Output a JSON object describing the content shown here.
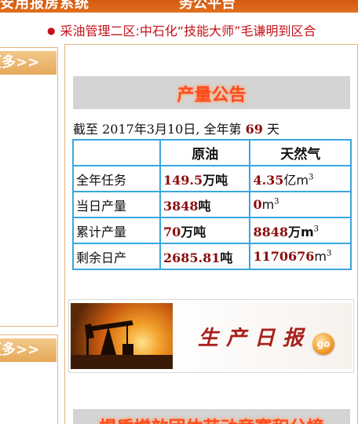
{
  "header": {
    "left_text": "安用报房系统",
    "right_text": "务公平台"
  },
  "news": {
    "text": "采油管理二区:中石化“技能大师”毛谦明到区合"
  },
  "sidebar": {
    "more_label_1": "更多>>",
    "more_label_2": "更多>>"
  },
  "announcement": {
    "title": "产量公告",
    "deadline_prefix": "截至 2017年3月10日, 全年第 ",
    "deadline_days": "69",
    "deadline_suffix": " 天"
  },
  "table": {
    "headers": [
      "",
      "原油",
      "天然气"
    ],
    "rows": [
      {
        "label": "全年任务",
        "oil_value": "149.5",
        "oil_unit": "万吨",
        "gas_value": "4.35",
        "gas_unit": "亿m",
        "gas_sup": "3"
      },
      {
        "label": "当日产量",
        "oil_value": "3848",
        "oil_unit": "吨",
        "gas_value": "0",
        "gas_unit": "m",
        "gas_sup": "3"
      },
      {
        "label": "累计产量",
        "oil_value": "70",
        "oil_unit": "万吨",
        "gas_value": "8848",
        "gas_unit": "万m",
        "gas_sup": "3"
      },
      {
        "label": "剩余日产",
        "oil_value": "2685.81",
        "oil_unit": "吨",
        "gas_value": "1170676",
        "gas_unit": "m",
        "gas_sup": "3"
      }
    ]
  },
  "daily_report": {
    "title": "生产日报",
    "go_label": "go"
  },
  "bottom_section": {
    "title": "提质增效团体劳动竞赛积分榜"
  },
  "colors": {
    "accent_orange": "#e0701e",
    "table_border": "#3aa6e0",
    "value_red": "#8a0d0d",
    "title_glow": "#ff4a1a"
  }
}
